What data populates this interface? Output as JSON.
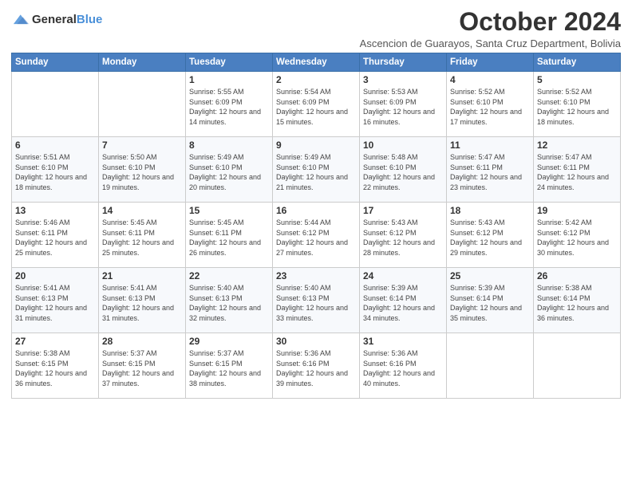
{
  "header": {
    "logo": {
      "general": "General",
      "blue": "Blue"
    },
    "month_title": "October 2024",
    "subtitle": "Ascencion de Guarayos, Santa Cruz Department, Bolivia"
  },
  "weekdays": [
    "Sunday",
    "Monday",
    "Tuesday",
    "Wednesday",
    "Thursday",
    "Friday",
    "Saturday"
  ],
  "weeks": [
    [
      {
        "day": "",
        "sunrise": "",
        "sunset": "",
        "daylight": ""
      },
      {
        "day": "",
        "sunrise": "",
        "sunset": "",
        "daylight": ""
      },
      {
        "day": "1",
        "sunrise": "Sunrise: 5:55 AM",
        "sunset": "Sunset: 6:09 PM",
        "daylight": "Daylight: 12 hours and 14 minutes."
      },
      {
        "day": "2",
        "sunrise": "Sunrise: 5:54 AM",
        "sunset": "Sunset: 6:09 PM",
        "daylight": "Daylight: 12 hours and 15 minutes."
      },
      {
        "day": "3",
        "sunrise": "Sunrise: 5:53 AM",
        "sunset": "Sunset: 6:09 PM",
        "daylight": "Daylight: 12 hours and 16 minutes."
      },
      {
        "day": "4",
        "sunrise": "Sunrise: 5:52 AM",
        "sunset": "Sunset: 6:10 PM",
        "daylight": "Daylight: 12 hours and 17 minutes."
      },
      {
        "day": "5",
        "sunrise": "Sunrise: 5:52 AM",
        "sunset": "Sunset: 6:10 PM",
        "daylight": "Daylight: 12 hours and 18 minutes."
      }
    ],
    [
      {
        "day": "6",
        "sunrise": "Sunrise: 5:51 AM",
        "sunset": "Sunset: 6:10 PM",
        "daylight": "Daylight: 12 hours and 18 minutes."
      },
      {
        "day": "7",
        "sunrise": "Sunrise: 5:50 AM",
        "sunset": "Sunset: 6:10 PM",
        "daylight": "Daylight: 12 hours and 19 minutes."
      },
      {
        "day": "8",
        "sunrise": "Sunrise: 5:49 AM",
        "sunset": "Sunset: 6:10 PM",
        "daylight": "Daylight: 12 hours and 20 minutes."
      },
      {
        "day": "9",
        "sunrise": "Sunrise: 5:49 AM",
        "sunset": "Sunset: 6:10 PM",
        "daylight": "Daylight: 12 hours and 21 minutes."
      },
      {
        "day": "10",
        "sunrise": "Sunrise: 5:48 AM",
        "sunset": "Sunset: 6:10 PM",
        "daylight": "Daylight: 12 hours and 22 minutes."
      },
      {
        "day": "11",
        "sunrise": "Sunrise: 5:47 AM",
        "sunset": "Sunset: 6:11 PM",
        "daylight": "Daylight: 12 hours and 23 minutes."
      },
      {
        "day": "12",
        "sunrise": "Sunrise: 5:47 AM",
        "sunset": "Sunset: 6:11 PM",
        "daylight": "Daylight: 12 hours and 24 minutes."
      }
    ],
    [
      {
        "day": "13",
        "sunrise": "Sunrise: 5:46 AM",
        "sunset": "Sunset: 6:11 PM",
        "daylight": "Daylight: 12 hours and 25 minutes."
      },
      {
        "day": "14",
        "sunrise": "Sunrise: 5:45 AM",
        "sunset": "Sunset: 6:11 PM",
        "daylight": "Daylight: 12 hours and 25 minutes."
      },
      {
        "day": "15",
        "sunrise": "Sunrise: 5:45 AM",
        "sunset": "Sunset: 6:11 PM",
        "daylight": "Daylight: 12 hours and 26 minutes."
      },
      {
        "day": "16",
        "sunrise": "Sunrise: 5:44 AM",
        "sunset": "Sunset: 6:12 PM",
        "daylight": "Daylight: 12 hours and 27 minutes."
      },
      {
        "day": "17",
        "sunrise": "Sunrise: 5:43 AM",
        "sunset": "Sunset: 6:12 PM",
        "daylight": "Daylight: 12 hours and 28 minutes."
      },
      {
        "day": "18",
        "sunrise": "Sunrise: 5:43 AM",
        "sunset": "Sunset: 6:12 PM",
        "daylight": "Daylight: 12 hours and 29 minutes."
      },
      {
        "day": "19",
        "sunrise": "Sunrise: 5:42 AM",
        "sunset": "Sunset: 6:12 PM",
        "daylight": "Daylight: 12 hours and 30 minutes."
      }
    ],
    [
      {
        "day": "20",
        "sunrise": "Sunrise: 5:41 AM",
        "sunset": "Sunset: 6:13 PM",
        "daylight": "Daylight: 12 hours and 31 minutes."
      },
      {
        "day": "21",
        "sunrise": "Sunrise: 5:41 AM",
        "sunset": "Sunset: 6:13 PM",
        "daylight": "Daylight: 12 hours and 31 minutes."
      },
      {
        "day": "22",
        "sunrise": "Sunrise: 5:40 AM",
        "sunset": "Sunset: 6:13 PM",
        "daylight": "Daylight: 12 hours and 32 minutes."
      },
      {
        "day": "23",
        "sunrise": "Sunrise: 5:40 AM",
        "sunset": "Sunset: 6:13 PM",
        "daylight": "Daylight: 12 hours and 33 minutes."
      },
      {
        "day": "24",
        "sunrise": "Sunrise: 5:39 AM",
        "sunset": "Sunset: 6:14 PM",
        "daylight": "Daylight: 12 hours and 34 minutes."
      },
      {
        "day": "25",
        "sunrise": "Sunrise: 5:39 AM",
        "sunset": "Sunset: 6:14 PM",
        "daylight": "Daylight: 12 hours and 35 minutes."
      },
      {
        "day": "26",
        "sunrise": "Sunrise: 5:38 AM",
        "sunset": "Sunset: 6:14 PM",
        "daylight": "Daylight: 12 hours and 36 minutes."
      }
    ],
    [
      {
        "day": "27",
        "sunrise": "Sunrise: 5:38 AM",
        "sunset": "Sunset: 6:15 PM",
        "daylight": "Daylight: 12 hours and 36 minutes."
      },
      {
        "day": "28",
        "sunrise": "Sunrise: 5:37 AM",
        "sunset": "Sunset: 6:15 PM",
        "daylight": "Daylight: 12 hours and 37 minutes."
      },
      {
        "day": "29",
        "sunrise": "Sunrise: 5:37 AM",
        "sunset": "Sunset: 6:15 PM",
        "daylight": "Daylight: 12 hours and 38 minutes."
      },
      {
        "day": "30",
        "sunrise": "Sunrise: 5:36 AM",
        "sunset": "Sunset: 6:16 PM",
        "daylight": "Daylight: 12 hours and 39 minutes."
      },
      {
        "day": "31",
        "sunrise": "Sunrise: 5:36 AM",
        "sunset": "Sunset: 6:16 PM",
        "daylight": "Daylight: 12 hours and 40 minutes."
      },
      {
        "day": "",
        "sunrise": "",
        "sunset": "",
        "daylight": ""
      },
      {
        "day": "",
        "sunrise": "",
        "sunset": "",
        "daylight": ""
      }
    ]
  ]
}
